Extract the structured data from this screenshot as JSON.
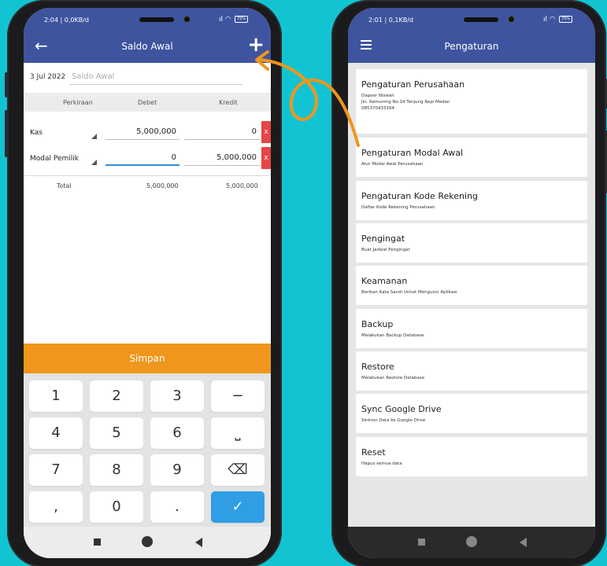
{
  "left_phone": {
    "status": {
      "time": "2:04 | 0,0KB/d",
      "battery": "75%"
    },
    "appbar": {
      "title": "Saldo Awal"
    },
    "date": "3 Jul 2022",
    "description_placeholder": "Saldo Awal",
    "columns": [
      "Perkiraan",
      "Debet",
      "Kredit"
    ],
    "rows": [
      {
        "account": "Kas",
        "debet": "5,000,000",
        "kredit": "0",
        "delete": "x"
      },
      {
        "account": "Modal Pemilik",
        "debet": "0",
        "kredit": "5,000,000",
        "delete": "x"
      }
    ],
    "total": {
      "label": "Total",
      "debet": "5,000,000",
      "kredit": "5,000,000"
    },
    "save_label": "Simpan",
    "keys": [
      "1",
      "2",
      "3",
      "−",
      "4",
      "5",
      "6",
      "⎵",
      "7",
      "8",
      "9",
      "⌫",
      ",",
      "0",
      ".",
      "✓"
    ]
  },
  "right_phone": {
    "status": {
      "time": "2:01 | 0,1KB/d",
      "battery": "75%"
    },
    "appbar": {
      "title": "Pengaturan"
    },
    "items": [
      {
        "title": "Pengaturan Perusahaan",
        "lines": [
          "Dapoer Niswah",
          "Jln. Kemuning No.14 Tanjung Rejo Medan",
          "085370433164"
        ]
      },
      {
        "title": "Pengaturan Modal Awal",
        "lines": [
          "Atur Modal Awal Perusahaan"
        ]
      },
      {
        "title": "Pengaturan Kode Rekening",
        "lines": [
          "Daftar Kode Rekening Perusahaan"
        ]
      },
      {
        "title": "Pengingat",
        "lines": [
          "Buat Jadwal Pengingat"
        ]
      },
      {
        "title": "Keamanan",
        "lines": [
          "Berikan Kata Sandi Untuk Mengunci Aplikasi"
        ]
      },
      {
        "title": "Backup",
        "lines": [
          "Melakukan Backup Database"
        ]
      },
      {
        "title": "Restore",
        "lines": [
          "Melakukan Restore Database"
        ]
      },
      {
        "title": "Sync Google Drive",
        "lines": [
          "Sinkron Data ke Google Drive"
        ]
      },
      {
        "title": "Reset",
        "lines": [
          "Hapus semua data"
        ]
      }
    ]
  },
  "colors": {
    "appbar": "#3e549e",
    "save": "#f0961c",
    "delete": "#e64545",
    "confirm": "#2f9ee4",
    "background": "#12c4d2"
  }
}
